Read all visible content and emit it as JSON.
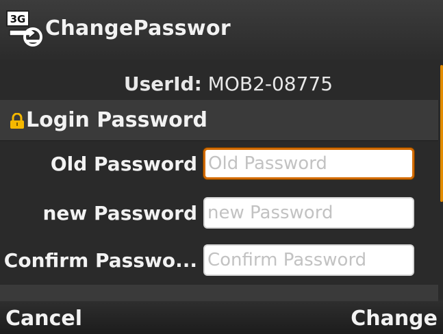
{
  "window": {
    "title": "ChangePasswor",
    "app_icon": "3g-network-icon",
    "app_icon_text": "3G"
  },
  "user": {
    "label": "UserId:",
    "value": "MOB2-08775"
  },
  "login_section": {
    "title": "Login Password",
    "icon": "lock-icon",
    "fields": [
      {
        "label": "Old Password",
        "placeholder": "Old Password",
        "value": "",
        "focused": true
      },
      {
        "label": "new Password",
        "placeholder": "new Password",
        "value": "",
        "focused": false
      },
      {
        "label": "Confirm Passwo...",
        "placeholder": "Confirm Password",
        "value": "",
        "focused": false
      }
    ]
  },
  "softkeys": {
    "left": "Cancel",
    "right": "Change"
  },
  "colors": {
    "accent": "#d36b00",
    "background": "#2a2a2a",
    "section": "#3a3a3a",
    "text": "#f2f2f2"
  }
}
